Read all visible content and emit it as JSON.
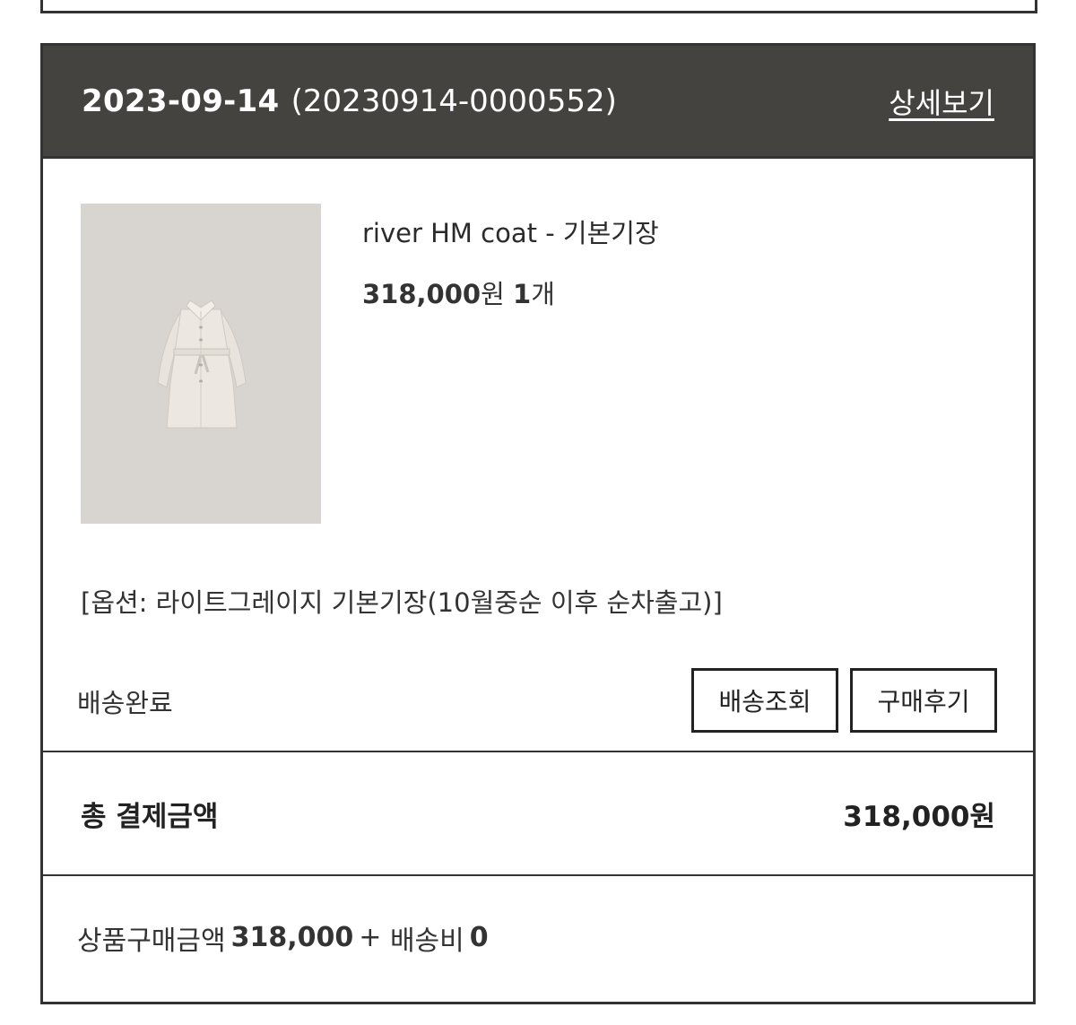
{
  "order": {
    "date": "2023-09-14",
    "order_number": "(20230914-0000552)",
    "detail_link": "상세보기"
  },
  "product": {
    "name": "river HM coat - 기본기장",
    "price": "318,000",
    "price_unit": "원",
    "quantity": "1",
    "quantity_unit": "개",
    "option": "[옵션: 라이트그레이지 기본기장(10월중순 이후 순차출고)]",
    "image_icon": "coat-product-image"
  },
  "shipping": {
    "status": "배송완료",
    "track_button": "배송조회",
    "review_button": "구매후기"
  },
  "total": {
    "label": "총 결제금액",
    "value": "318,000원"
  },
  "breakdown": {
    "product_label": "상품구매금액",
    "product_amount": "318,000",
    "plus": "+",
    "shipping_label": "배송비",
    "shipping_amount": "0"
  },
  "colors": {
    "header_bg": "#45433f",
    "thumb_bg": "#d8d4cf",
    "border": "#333333"
  }
}
